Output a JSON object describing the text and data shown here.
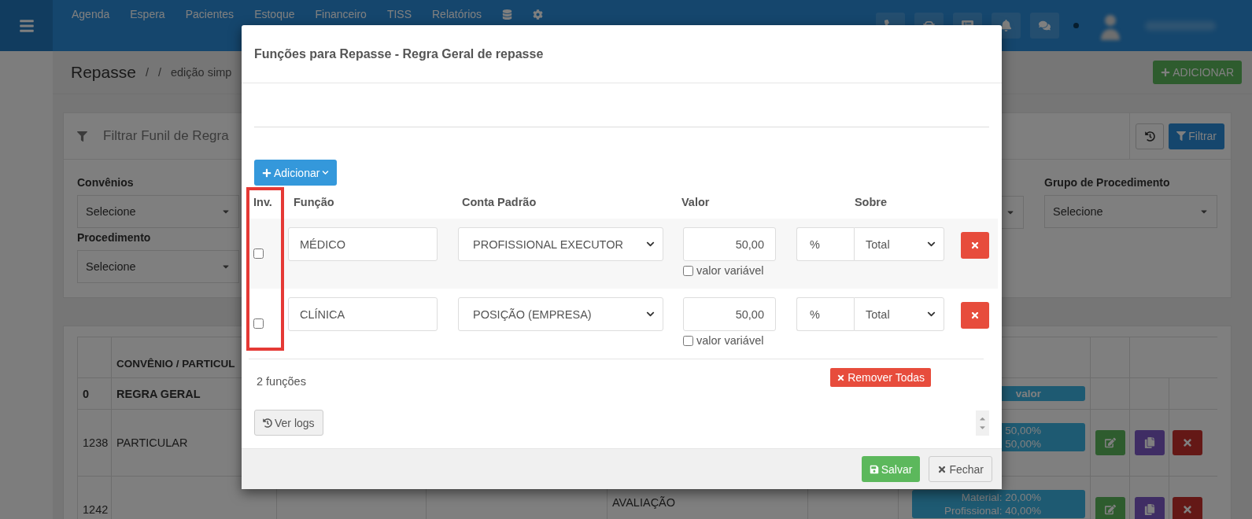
{
  "navbar": {
    "items": [
      "Agenda",
      "Espera",
      "Pacientes",
      "Estoque",
      "Financeiro",
      "TISS",
      "Relatórios"
    ]
  },
  "breadcrumb": [
    "Repasse",
    "/",
    "/",
    "edição simp"
  ],
  "add_button": "ADICIONAR",
  "filter_panel": {
    "title": "Filtrar Funil de Regra",
    "filter_button": "Filtrar",
    "fields": [
      {
        "label": "Convênios",
        "value": "Selecione"
      },
      {
        "label": "Procedimento",
        "value": "Selecione"
      },
      {
        "label": "Grupo de Procedimento",
        "value": "Selecione"
      }
    ]
  },
  "table": {
    "columns": [
      "CONVÊNIO / PARTICUL"
    ],
    "rows": [
      {
        "kind": "total",
        "id": "0",
        "name": "REGRA GERAL",
        "summary": [
          "valor"
        ],
        "actions": false
      },
      {
        "kind": "entry",
        "id": "1238",
        "name": "PARTICULAR",
        "summary": [
          "50,00%",
          "50,00%"
        ],
        "actions": true
      },
      {
        "kind": "entry",
        "id": "1242",
        "procedure": "AVALIAÇÃO",
        "summary": [
          "Material: 20,00%",
          "Profissional: 40,00%"
        ],
        "actions": true
      }
    ]
  },
  "modal": {
    "title": "Funções para Repasse - Regra Geral de repasse",
    "add_button": "Adicionar",
    "highlight_inv_column": true,
    "columns": [
      "Inv.",
      "Função",
      "Conta Padrão",
      "Valor",
      "Sobre"
    ],
    "rows": [
      {
        "inverted": false,
        "function": "MÉDICO",
        "account": "PROFISSIONAL EXECUTOR",
        "value": "50,00",
        "variable": false,
        "variable_label": "valor variável",
        "unit": "%",
        "base": "Total"
      },
      {
        "inverted": false,
        "function": "CLÍNICA",
        "account": "POSIÇÃO (EMPRESA)",
        "value": "50,00",
        "variable": false,
        "variable_label": "valor variável",
        "unit": "%",
        "base": "Total"
      }
    ],
    "count": "2 funções",
    "remove_all": "Remover Todas",
    "logs_button": "Ver logs",
    "save_button": "Salvar",
    "close_button": "Fechar"
  }
}
